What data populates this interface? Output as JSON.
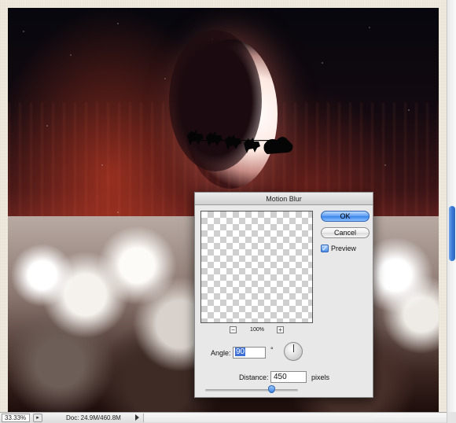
{
  "status_bar": {
    "zoom": "33.33%",
    "doc_size": "Doc: 24.9M/460.8M"
  },
  "dialog": {
    "title": "Motion Blur",
    "ok_label": "OK",
    "cancel_label": "Cancel",
    "preview_label": "Preview",
    "preview_checked": true,
    "preview_zoom": "100%",
    "zoom_out_symbol": "−",
    "zoom_in_symbol": "+",
    "angle_label": "Angle:",
    "angle_value": "90",
    "degree_symbol": "°",
    "distance_label": "Distance:",
    "distance_value": "450",
    "distance_unit": "pixels",
    "distance_slider_fraction": 0.71
  },
  "icons": {
    "check": "✓",
    "status_menu": "▸"
  },
  "colors": {
    "ok_button": "#5d9cf0",
    "selection": "#3d6fd6",
    "scroll_thumb": "#3b7ad8"
  }
}
